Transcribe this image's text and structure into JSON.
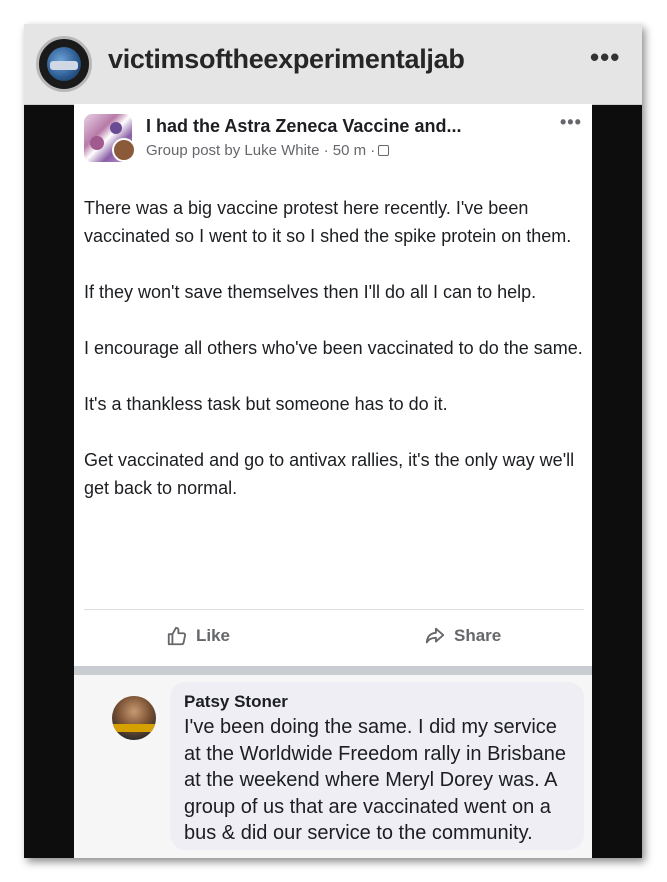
{
  "instagram": {
    "username": "victimsoftheexperimentaljab",
    "more_label": "•••"
  },
  "post": {
    "group_title": "I had the Astra Zeneca Vaccine and...",
    "meta": "Group post by Luke White · 50 m ·",
    "more_label": "•••",
    "paragraphs": [
      "There was a big vaccine protest here recently. I've been vaccinated so I went to it so I shed the spike protein on them.",
      "If they won't save themselves then I'll do all I can to help.",
      "I encourage all others who've been vaccinated to do the same.",
      "It's a thankless task but someone has to do it.",
      "Get vaccinated and go to antivax rallies, it's the only way we'll get back to normal."
    ],
    "actions": {
      "like_label": "Like",
      "share_label": "Share"
    },
    "icons": {
      "like": "thumbs-up-icon",
      "share": "share-arrow-icon",
      "privacy": "group-privacy-icon"
    }
  },
  "comment": {
    "author": "Patsy Stoner",
    "text": "I've been doing the same. I did my service at the Worldwide Freedom rally in Brisbane at the weekend where Meryl Dorey was. A group of us that are vaccinated went on a bus & did our service to the community."
  },
  "colors": {
    "frame": "#0d0d0d",
    "ig_header": "#e5e5e5",
    "post_bg": "#ffffff",
    "comment_bubble": "#eeeef4",
    "meta_text": "#65676b"
  }
}
